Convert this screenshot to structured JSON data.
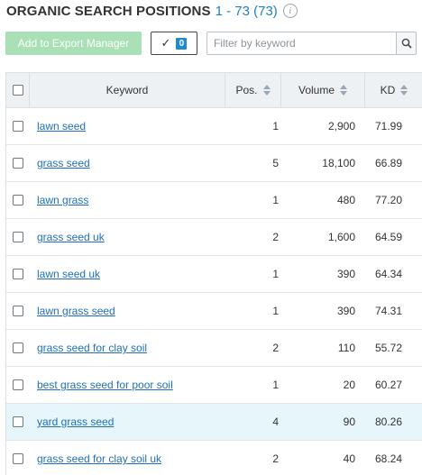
{
  "header": {
    "title": "ORGANIC SEARCH POSITIONS",
    "range": "1 - 73 (73)",
    "info_icon": "info-icon"
  },
  "toolbar": {
    "export_label": "Add to Export Manager",
    "selected_count": "0",
    "filter_placeholder": "Filter by keyword",
    "colors": {
      "export_button": "#a9e0b5",
      "badge": "#1f8ad1"
    }
  },
  "table": {
    "columns": [
      "Keyword",
      "Pos.",
      "Volume",
      "KD"
    ],
    "highlight_color": "#e6f6fb",
    "rows": [
      {
        "keyword": "lawn seed",
        "pos": "1",
        "volume": "2,900",
        "kd": "71.99"
      },
      {
        "keyword": "grass seed",
        "pos": "5",
        "volume": "18,100",
        "kd": "66.89"
      },
      {
        "keyword": "lawn grass",
        "pos": "1",
        "volume": "480",
        "kd": "77.20"
      },
      {
        "keyword": "grass seed uk",
        "pos": "2",
        "volume": "1,600",
        "kd": "64.59"
      },
      {
        "keyword": "lawn seed uk",
        "pos": "1",
        "volume": "390",
        "kd": "64.34"
      },
      {
        "keyword": "lawn grass seed",
        "pos": "1",
        "volume": "390",
        "kd": "74.31"
      },
      {
        "keyword": "grass seed for clay soil",
        "pos": "2",
        "volume": "110",
        "kd": "55.72"
      },
      {
        "keyword": "best grass seed for poor soil",
        "pos": "1",
        "volume": "20",
        "kd": "60.27"
      },
      {
        "keyword": "yard grass seed",
        "pos": "4",
        "volume": "90",
        "kd": "80.26",
        "highlighted": true
      },
      {
        "keyword": "grass seed for clay soil uk",
        "pos": "2",
        "volume": "40",
        "kd": "68.24"
      }
    ]
  }
}
